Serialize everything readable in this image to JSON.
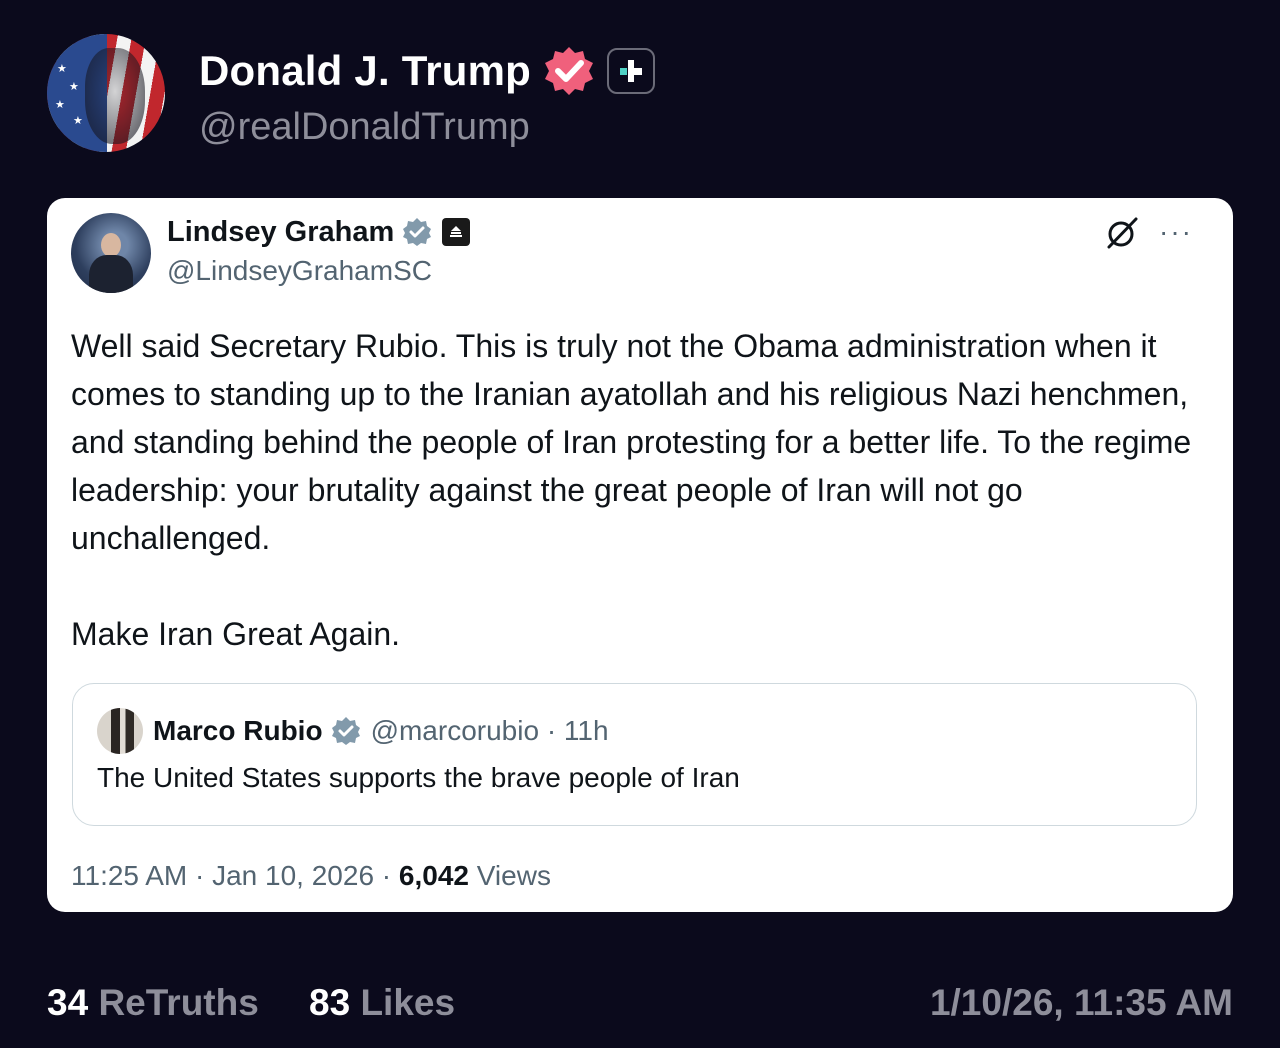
{
  "header": {
    "display_name": "Donald J. Trump",
    "handle": "@realDonaldTrump"
  },
  "quoted_post": {
    "author_name": "Lindsey Graham",
    "author_handle": "@LindseyGrahamSC",
    "paragraphs": [
      "Well said Secretary Rubio. This is truly not the Obama administration when it comes to standing up to the Iranian ayatollah and his religious Nazi henchmen, and standing behind the people of Iran protesting for a better life. To the regime leadership: your brutality against the great people of Iran will not go unchallenged.",
      "Make Iran Great Again."
    ],
    "embedded": {
      "author_name": "Marco Rubio",
      "meta": "@marcorubio · 11h",
      "text": "The United States supports the brave people of Iran"
    },
    "time": "11:25 AM · Jan 10, 2026 · ",
    "views_count": "6,042",
    "views_label": " Views",
    "more_glyph": "···"
  },
  "footer": {
    "retruths_count": "34",
    "retruths_label": "ReTruths",
    "likes_count": "83",
    "likes_label": "Likes",
    "timestamp": "1/10/26, 11:35 AM"
  },
  "colors": {
    "background": "#0b0a1c",
    "verified_badge": "#f0607c",
    "accent_plus": "#4fd1c5",
    "card_bg": "#ffffff"
  },
  "icons": [
    "verified-icon",
    "truth-plus-icon",
    "gray-check-icon",
    "government-badge-icon",
    "grok-icon",
    "more-options-icon"
  ]
}
